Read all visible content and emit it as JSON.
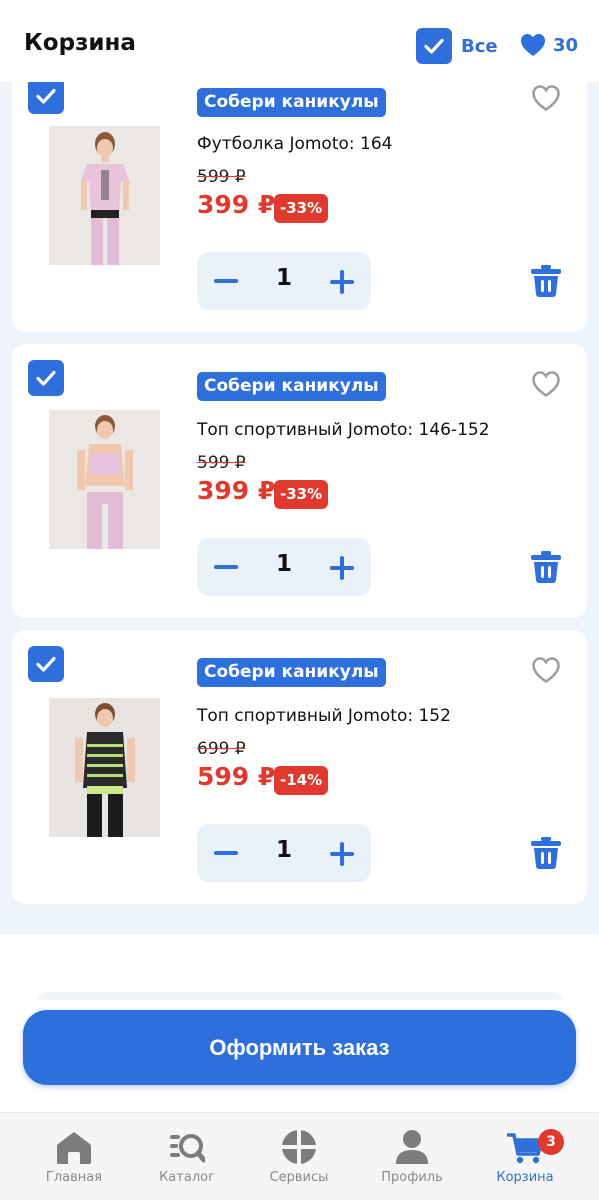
{
  "header": {
    "title": "Корзина",
    "select_all_label": "Все",
    "favorites_count": "30"
  },
  "cart_items": [
    {
      "promo": "Собери каникулы",
      "name": "Футболка Jomoto: 164",
      "old_price": "599 ₽",
      "new_price": "399 ₽",
      "discount": "-33%",
      "quantity": "1",
      "selected": true
    },
    {
      "promo": "Собери каникулы",
      "name": "Топ спортивный Jomoto: 146-152",
      "old_price": "599 ₽",
      "new_price": "399 ₽",
      "discount": "-33%",
      "quantity": "1",
      "selected": true
    },
    {
      "promo": "Собери каникулы",
      "name": "Топ спортивный Jomoto: 152",
      "old_price": "699 ₽",
      "new_price": "599 ₽",
      "discount": "-14%",
      "quantity": "1",
      "selected": true
    }
  ],
  "checkout": {
    "label": "Оформить заказ"
  },
  "bottom_nav": {
    "items": [
      {
        "label": "Главная",
        "icon": "home-icon"
      },
      {
        "label": "Каталог",
        "icon": "catalog-icon"
      },
      {
        "label": "Сервисы",
        "icon": "services-icon"
      },
      {
        "label": "Профиль",
        "icon": "profile-icon"
      },
      {
        "label": "Корзина",
        "icon": "cart-icon",
        "badge": "3",
        "active": true
      }
    ]
  },
  "colors": {
    "accent": "#2f6fdb",
    "price_red": "#e03a2f",
    "list_background": "#eef4fb"
  }
}
